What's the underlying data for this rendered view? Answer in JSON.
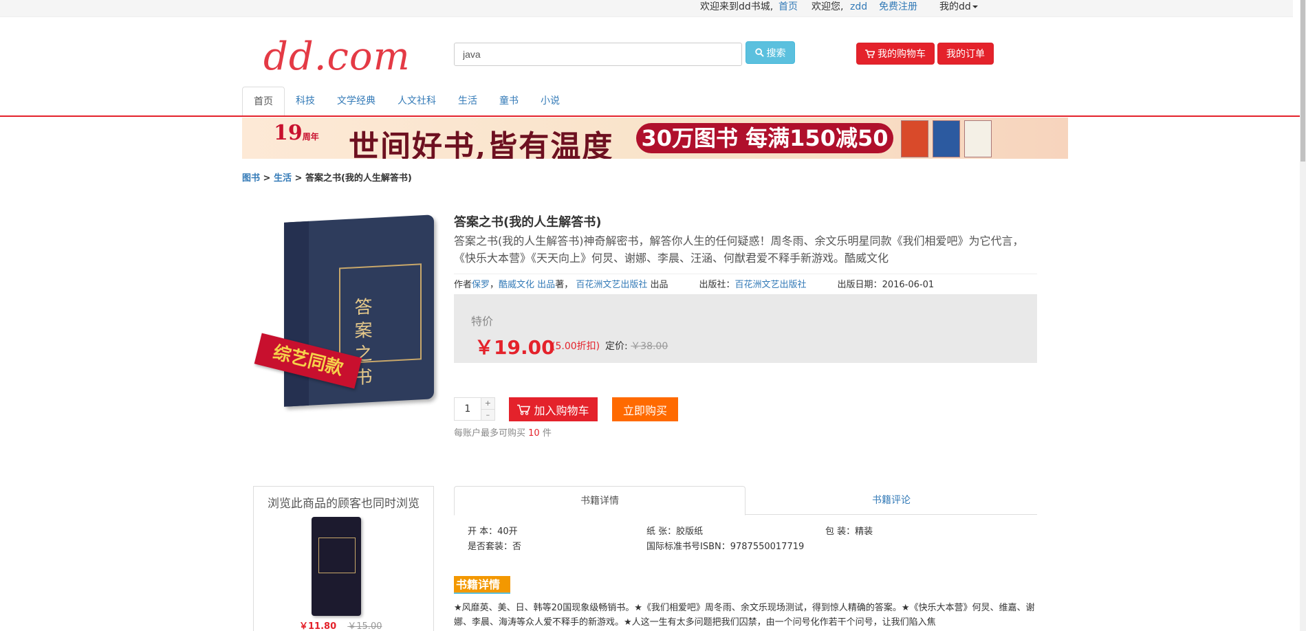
{
  "topbar": {
    "welcome_store": "欢迎来到dd书城,",
    "home_link": "首页",
    "welcome_user": "欢迎您,",
    "username": "zdd",
    "register_link": "免费注册",
    "my_menu": "我的dd"
  },
  "header": {
    "logo": "dd.com",
    "search_value": "java",
    "search_button": "搜索",
    "cart_button": "我的购物车",
    "orders_button": "我的订单"
  },
  "nav": {
    "items": [
      "首页",
      "科技",
      "文学经典",
      "人文社科",
      "生活",
      "童书",
      "小说"
    ]
  },
  "banner": {
    "anniversary": "19",
    "anniversary_suffix": "周年",
    "slogan": "世间好书,皆有温度",
    "promo": "30万图书 每满150减50"
  },
  "breadcrumb": {
    "root": "图书",
    "category": "生活",
    "current": "答案之书(我的人生解答书)"
  },
  "product": {
    "cover_title": "答案之书",
    "cover_ribbon": "综艺同款",
    "title": "答案之书(我的人生解答书)",
    "description": "答案之书(我的人生解答书)神奇解密书，解答你人生的任何疑惑！周冬雨、余文乐明星同款《我们相爱吧》为它代言，《快乐大本营》《天天向上》何炅、谢娜、李晨、汪涵、何猷君爱不释手新游戏。酷威文化",
    "author_label": "作者",
    "author": "保罗",
    "author_sep": "，",
    "producer1": "酷威文化 出品",
    "author_suffix": "著，",
    "producer2": "百花洲文艺出版社",
    "producer2_suffix": "出品",
    "publisher_label": "出版社：",
    "publisher": "百花洲文艺出版社",
    "date_label": "出版日期：",
    "date": "2016-06-01"
  },
  "price": {
    "label": "特价",
    "price": "￥19.00",
    "discount": "(5.00折扣)",
    "list_label": "定价:",
    "list_price": "￥38.00"
  },
  "purchase": {
    "quantity": "1",
    "plus": "+",
    "minus": "–",
    "add_to_cart": "加入购物车",
    "buy_now": "立即购买",
    "limit_prefix": "每账户最多可购买",
    "limit_count": "10",
    "limit_suffix": "件"
  },
  "sidebar": {
    "heading": "浏览此商品的顾客也同时浏览",
    "item_price": "￥11.80",
    "item_list_price": "￥15.00"
  },
  "tabs": {
    "details": "书籍详情",
    "reviews": "书籍评论"
  },
  "specs": {
    "format": "开 本：40开",
    "paper": "纸 张：胶版纸",
    "binding": "包 装：精装",
    "is_set": "是否套装：否",
    "isbn": "国际标准书号ISBN：9787550017719"
  },
  "details": {
    "section_title": "书籍详情",
    "text": "★风靡英、美、日、韩等20国现象级畅销书。★《我们相爱吧》周冬雨、余文乐现场测试，得到惊人精确的答案。★《快乐大本营》何炅、维嘉、谢娜、李晨、海涛等众人爱不释手的新游戏。★人这一生有太多问题把我们囚禁，由一个问号化作若干个问号，让我们陷入焦"
  },
  "colors": {
    "brand_red": "#e4222b",
    "buy_orange": "#ff6a00",
    "search_blue": "#5bc0de",
    "link_blue": "#337ab7"
  }
}
